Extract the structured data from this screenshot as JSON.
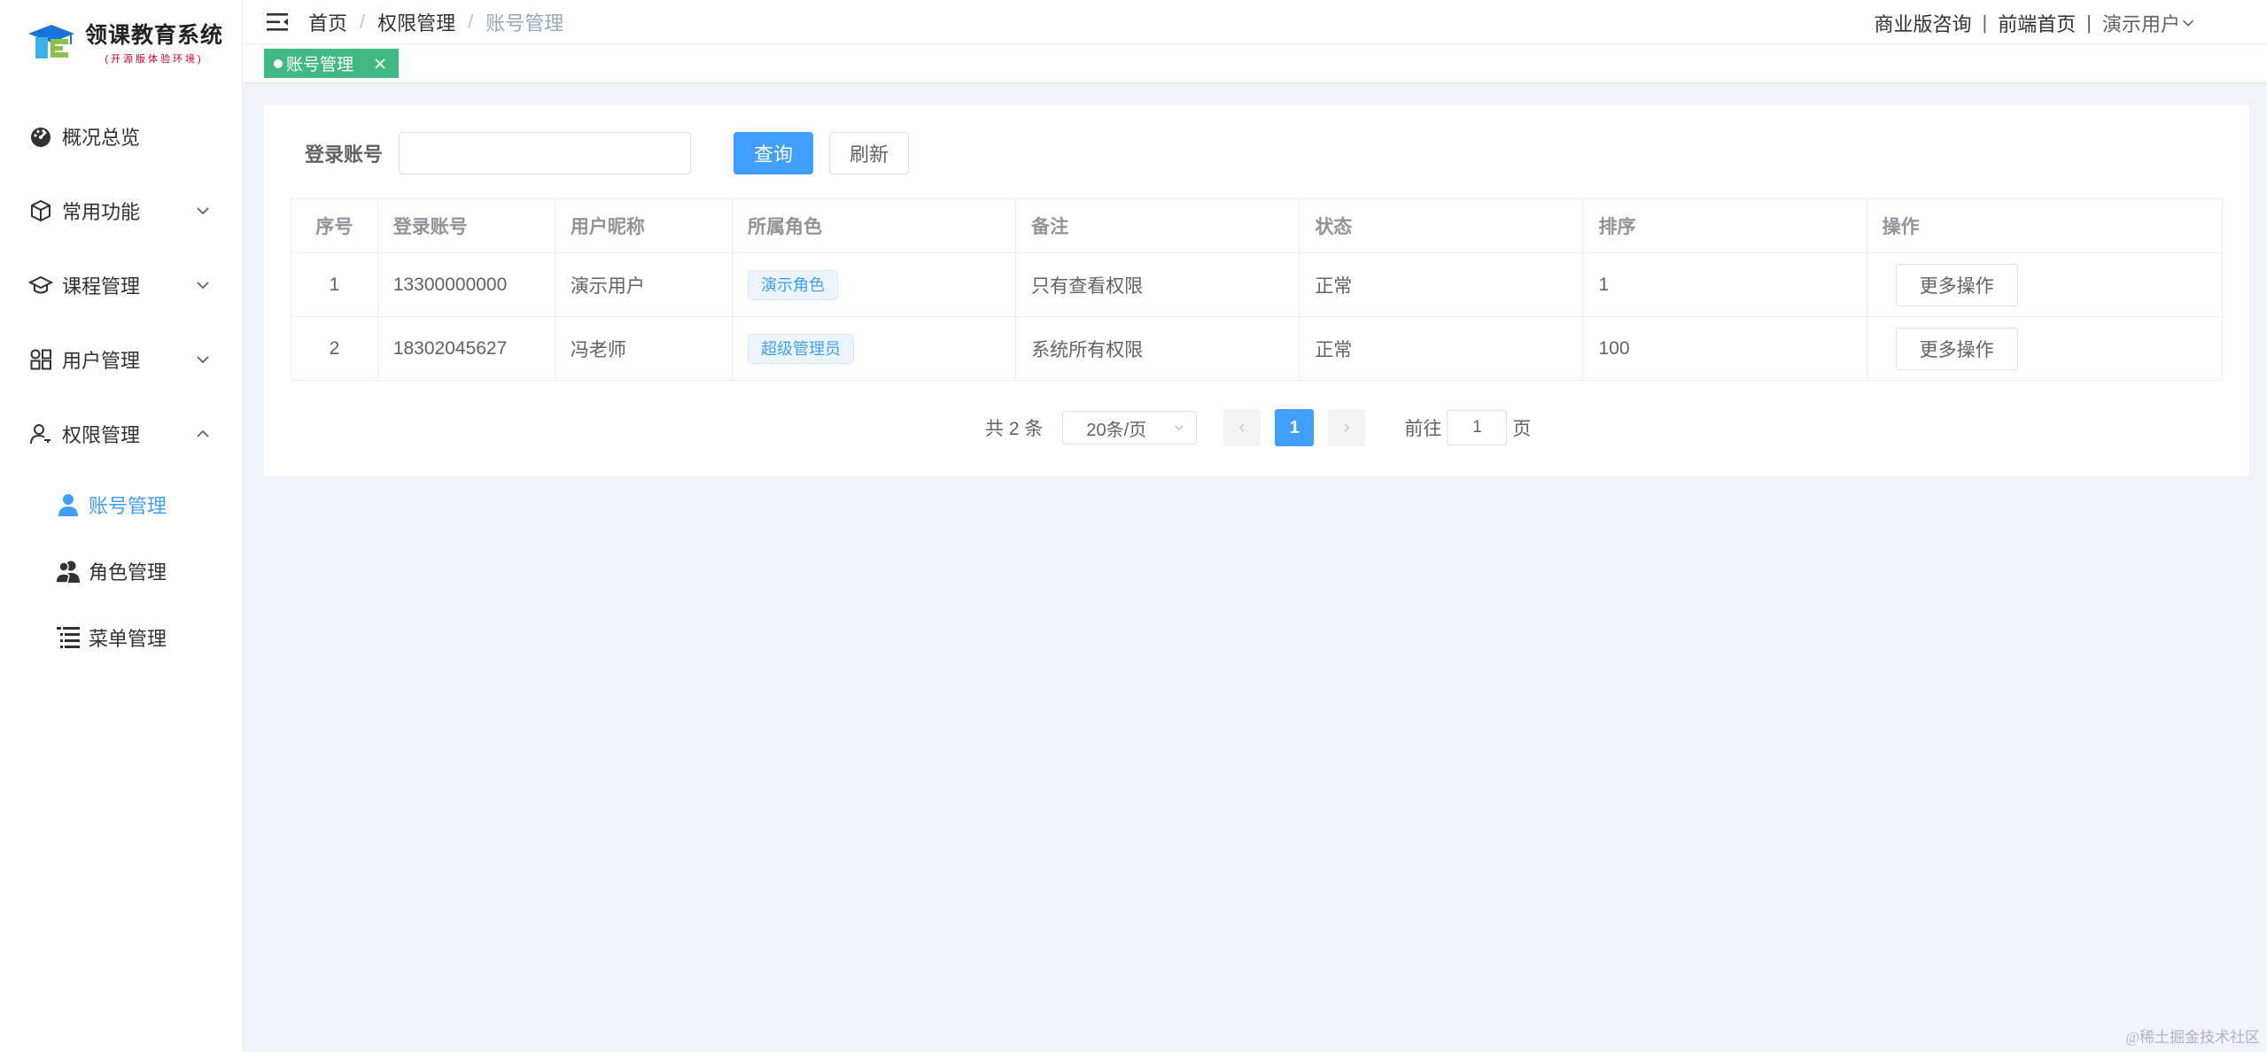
{
  "logo": {
    "title": "领课教育系统",
    "subtitle": "(开源版体验环境)",
    "colors": [
      "#1a73d9",
      "#8bc34a",
      "#3bb0e8"
    ]
  },
  "sidebar": {
    "items": [
      {
        "label": "概况总览",
        "icon": "dashboard-icon"
      },
      {
        "label": "常用功能",
        "icon": "cube-icon",
        "chevron": "down"
      },
      {
        "label": "课程管理",
        "icon": "graduation-cap-icon",
        "chevron": "down"
      },
      {
        "label": "用户管理",
        "icon": "apps-icon",
        "chevron": "down"
      },
      {
        "label": "权限管理",
        "icon": "user-key-icon",
        "chevron": "up"
      }
    ],
    "subitems": [
      {
        "label": "账号管理",
        "icon": "user-icon",
        "active": true
      },
      {
        "label": "角色管理",
        "icon": "users-icon",
        "active": false
      },
      {
        "label": "菜单管理",
        "icon": "list-icon",
        "active": false
      }
    ]
  },
  "header": {
    "breadcrumb": [
      "首页",
      "权限管理",
      "账号管理"
    ],
    "links": [
      "商业版咨询",
      "前端首页"
    ],
    "user": "演示用户"
  },
  "tags": [
    {
      "label": "账号管理",
      "color": "#42b983"
    }
  ],
  "search": {
    "label": "登录账号",
    "value": "",
    "placeholder": "",
    "query_label": "查询",
    "refresh_label": "刷新"
  },
  "table": {
    "columns": [
      "序号",
      "登录账号",
      "用户昵称",
      "所属角色",
      "备注",
      "状态",
      "排序",
      "操作"
    ],
    "rows": [
      {
        "index": "1",
        "account": "13300000000",
        "nickname": "演示用户",
        "role": "演示角色",
        "remark": "只有查看权限",
        "status": "正常",
        "sort": "1",
        "action": "更多操作"
      },
      {
        "index": "2",
        "account": "18302045627",
        "nickname": "冯老师",
        "role": "超级管理员",
        "remark": "系统所有权限",
        "status": "正常",
        "sort": "100",
        "action": "更多操作"
      }
    ]
  },
  "pagination": {
    "total_text": "共 2 条",
    "page_size": "20条/页",
    "current_page": "1",
    "goto_label": "前往",
    "goto_value": "1",
    "goto_suffix": "页"
  },
  "theme": {
    "primary": "#409eff",
    "tag_green": "#42b983"
  },
  "watermark": "@稀土掘金技术社区"
}
